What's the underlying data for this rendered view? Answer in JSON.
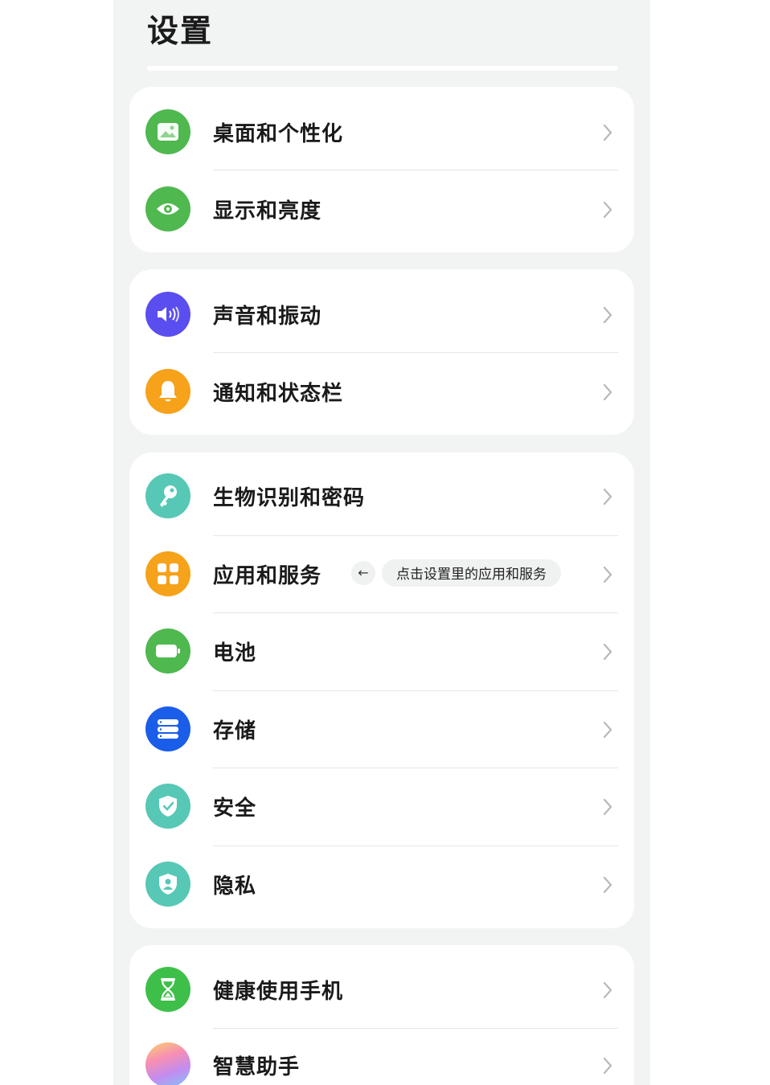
{
  "page": {
    "title": "设置"
  },
  "groups": [
    {
      "items": [
        {
          "label": "桌面和个性化",
          "icon": "wallpaper-icon",
          "color": "#4fb84f"
        },
        {
          "label": "显示和亮度",
          "icon": "eye-icon",
          "color": "#4fb84f"
        }
      ]
    },
    {
      "items": [
        {
          "label": "声音和振动",
          "icon": "speaker-icon",
          "color": "#5a4ef0"
        },
        {
          "label": "通知和状态栏",
          "icon": "bell-icon",
          "color": "#f6a21a"
        }
      ]
    },
    {
      "items": [
        {
          "label": "生物识别和密码",
          "icon": "key-icon",
          "color": "#56c8b5"
        },
        {
          "label": "应用和服务",
          "icon": "apps-grid-icon",
          "color": "#f6a21a",
          "tip": {
            "arrow": "←",
            "text": "点击设置里的应用和服务"
          }
        },
        {
          "label": "电池",
          "icon": "battery-icon",
          "color": "#4fb84f"
        },
        {
          "label": "存储",
          "icon": "storage-icon",
          "color": "#1a5de8"
        },
        {
          "label": "安全",
          "icon": "shield-check-icon",
          "color": "#56c8b5"
        },
        {
          "label": "隐私",
          "icon": "privacy-shield-icon",
          "color": "#56c8b5"
        }
      ]
    },
    {
      "items": [
        {
          "label": "健康使用手机",
          "icon": "hourglass-icon",
          "color": "#3ebf4a"
        },
        {
          "label": "智慧助手",
          "icon": "assistant-orb-icon",
          "color": "#c9a8ef"
        }
      ]
    }
  ]
}
